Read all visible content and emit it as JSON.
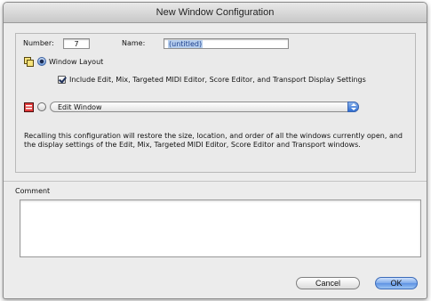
{
  "window": {
    "title": "New Window Configuration"
  },
  "config": {
    "number_label": "Number:",
    "number_value": "7",
    "name_label": "Name:",
    "name_value": "(untitled)"
  },
  "options": {
    "window_layout": {
      "label": "Window Layout",
      "selected": true,
      "icon": "window-layout-icon"
    },
    "include_settings": {
      "label": "Include Edit, Mix, Targeted MIDI Editor, Score Editor, and Transport Display Settings",
      "checked": true
    },
    "single_window": {
      "selected": false,
      "icon": "window-icon",
      "dropdown_value": "Edit Window"
    }
  },
  "description": "Recalling this configuration will restore the size, location, and order of all the windows currently open, and the display settings of the Edit, Mix, Targeted MIDI Editor, Score Editor and Transport windows.",
  "comment": {
    "label": "Comment",
    "value": ""
  },
  "buttons": {
    "cancel": "Cancel",
    "ok": "OK"
  },
  "colors": {
    "accent": "#5d92e3",
    "selection": "#b7cfee"
  }
}
